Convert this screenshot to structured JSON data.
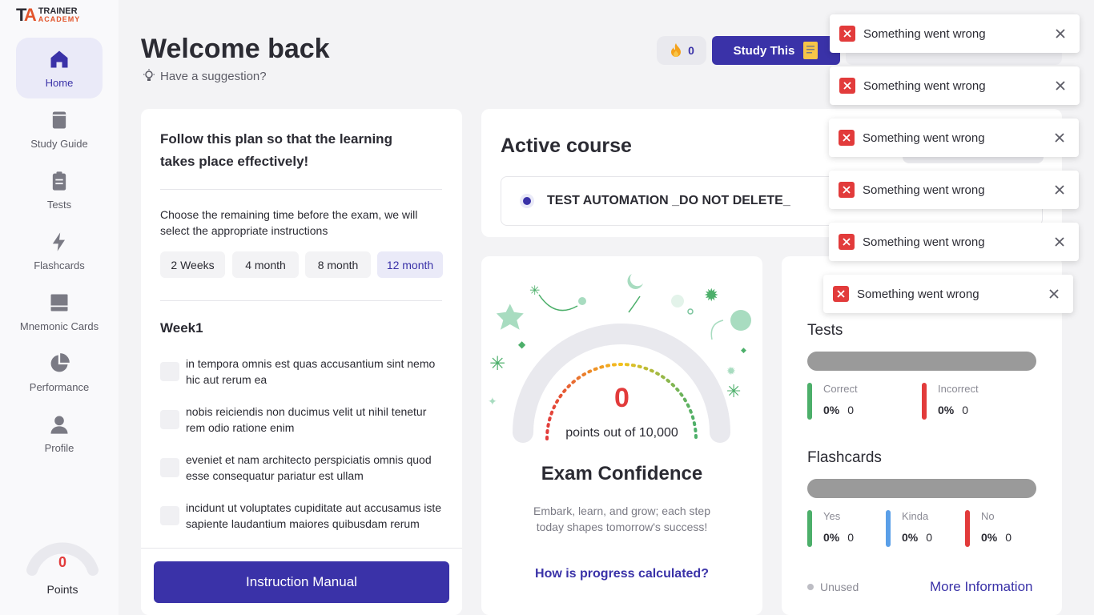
{
  "logo": {
    "mark": "TA",
    "line1": "TRAINER",
    "line2": "ACADEMY"
  },
  "sidebar": {
    "items": [
      {
        "label": "Home"
      },
      {
        "label": "Study Guide"
      },
      {
        "label": "Tests"
      },
      {
        "label": "Flashcards"
      },
      {
        "label": "Mnemonic Cards"
      },
      {
        "label": "Performance"
      },
      {
        "label": "Profile"
      }
    ],
    "points": {
      "value": "0",
      "label": "Points"
    }
  },
  "header": {
    "title": "Welcome back",
    "suggestion": "Have a suggestion?",
    "streak": "0",
    "study_button": "Study This"
  },
  "plan": {
    "heading": "Follow this plan so that the learning takes place effectively!",
    "choose_text": "Choose the remaining time before the exam, we will select the appropriate instructions",
    "options": [
      "2 Weeks",
      "4 month",
      "8 month",
      "12 month"
    ],
    "selected_option": "12 month",
    "week_label": "Week1",
    "tasks": [
      "in tempora omnis est quas accusantium sint nemo hic aut rerum ea",
      "nobis reiciendis non ducimus velit ut nihil tenetur rem odio ratione enim",
      "eveniet et nam architecto perspiciatis omnis quod esse consequatur pariatur est ullam",
      "incidunt ut voluptates cupiditate aut accusamus iste sapiente laudantium maiores quibusdam rerum"
    ],
    "manual_button": "Instruction Manual"
  },
  "active_course": {
    "heading": "Active course",
    "course_name": "TEST AUTOMATION _DO NOT DELETE_"
  },
  "confidence": {
    "value": "0",
    "subtitle": "points out of 10,000",
    "progress_fraction": 0,
    "title": "Exam Confidence",
    "description": "Embark, learn, and grow; each step today shapes tomorrow's success!",
    "link": "How is progress calculated?"
  },
  "stats": {
    "tests": {
      "heading": "Tests",
      "correct": {
        "label": "Correct",
        "percent": "0%",
        "count": "0"
      },
      "incorrect": {
        "label": "Incorrect",
        "percent": "0%",
        "count": "0"
      }
    },
    "flashcards": {
      "heading": "Flashcards",
      "yes": {
        "label": "Yes",
        "percent": "0%",
        "count": "0"
      },
      "kinda": {
        "label": "Kinda",
        "percent": "0%",
        "count": "0"
      },
      "no": {
        "label": "No",
        "percent": "0%",
        "count": "0"
      }
    },
    "unused_label": "Unused",
    "more_info": "More Information"
  },
  "toasts": [
    {
      "message": "Something went wrong"
    },
    {
      "message": "Something went wrong"
    },
    {
      "message": "Something went wrong"
    },
    {
      "message": "Something went wrong"
    },
    {
      "message": "Something went wrong"
    },
    {
      "message": "Something went wrong"
    }
  ],
  "colors": {
    "primary": "#3a32a8",
    "error": "#e23b3b",
    "success": "#4caf6a",
    "info": "#5a9fe8"
  },
  "icons": {
    "home": "home-icon",
    "study_guide": "book-icon",
    "tests": "clipboard-icon",
    "flashcards": "bolt-icon",
    "mnemonic": "card-icon",
    "performance": "pie-chart-icon",
    "profile": "user-icon"
  }
}
